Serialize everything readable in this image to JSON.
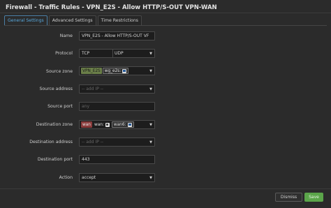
{
  "dialog": {
    "title": "Firewall - Traffic Rules - VPN_E2S - Allow HTTP/S-OUT VPN-WAN"
  },
  "tabs": [
    {
      "label": "General Settings",
      "active": true
    },
    {
      "label": "Advanced Settings",
      "active": false
    },
    {
      "label": "Time Restrictions",
      "active": false
    }
  ],
  "form": {
    "name": {
      "label": "Name",
      "value": "VPN_E2S - Allow HTTP/S-OUT VF"
    },
    "protocol": {
      "label": "Protocol",
      "values": [
        "TCP",
        "UDP"
      ]
    },
    "source_zone": {
      "label": "Source zone",
      "chip_zone": "VPN_E2S",
      "chip_iface": "wg_e2s:"
    },
    "source_address": {
      "label": "Source address",
      "placeholder": "-- add IP --"
    },
    "source_port": {
      "label": "Source port",
      "placeholder": "any"
    },
    "destination_zone": {
      "label": "Destination zone",
      "chip_zone": "wan",
      "chip_iface1": "wan:",
      "chip_iface2": "wan6:"
    },
    "destination_address": {
      "label": "Destination address",
      "placeholder": "-- add IP --"
    },
    "destination_port": {
      "label": "Destination port",
      "value": "443"
    },
    "action": {
      "label": "Action",
      "value": "accept"
    }
  },
  "footer": {
    "dismiss_label": "Dismiss",
    "save_label": "Save"
  },
  "colors": {
    "accent": "#58a9de",
    "save": "#5ba54a",
    "zone_vpn": "#6b7f49",
    "zone_wan": "#8a3b3b"
  }
}
